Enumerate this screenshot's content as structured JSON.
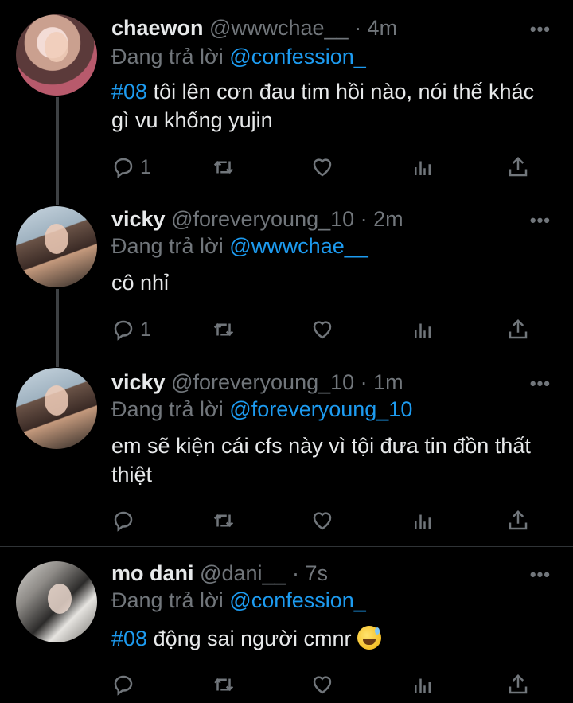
{
  "tweets": [
    {
      "name": "chaewon",
      "handle": "@wwwchae__",
      "time": "· 4m",
      "reply_prefix": "Đang trả lời",
      "reply_to": "@confession_",
      "hashtag": "#08",
      "text": " tôi lên cơn đau tim hồi nào, nói thế khác gì vu khống yujin",
      "reply_count": "1",
      "avatar": "avatar-chaewon"
    },
    {
      "name": "vicky",
      "handle": "@foreveryoung_10",
      "time": "· 2m",
      "reply_prefix": "Đang trả lời",
      "reply_to": "@wwwchae__",
      "hashtag": "",
      "text": "cô nhỉ",
      "reply_count": "1",
      "avatar": "avatar-vicky"
    },
    {
      "name": "vicky",
      "handle": "@foreveryoung_10",
      "time": "· 1m",
      "reply_prefix": "Đang trả lời",
      "reply_to": "@foreveryoung_10",
      "hashtag": "",
      "text": "em sẽ kiện cái cfs này vì tội đưa tin đồn thất thiệt",
      "reply_count": "",
      "avatar": "avatar-vicky"
    },
    {
      "name": "mo dani",
      "handle": "@dani__",
      "time": "· 7s",
      "reply_prefix": "Đang trả lời",
      "reply_to": "@confession_",
      "hashtag": "#08",
      "text": " động sai người cmnr ",
      "emoji": "grinning-face-with-sweat-emoji",
      "reply_count": "",
      "avatar": "avatar-dani"
    }
  ],
  "icons": {
    "more": "more-icon",
    "reply": "reply-icon",
    "retweet": "retweet-icon",
    "like": "heart-icon",
    "analytics": "analytics-icon",
    "share": "share-icon"
  },
  "colors": {
    "background": "#000000",
    "link": "#1d9bf0",
    "muted": "#71767b",
    "text": "#e7e9ea"
  }
}
